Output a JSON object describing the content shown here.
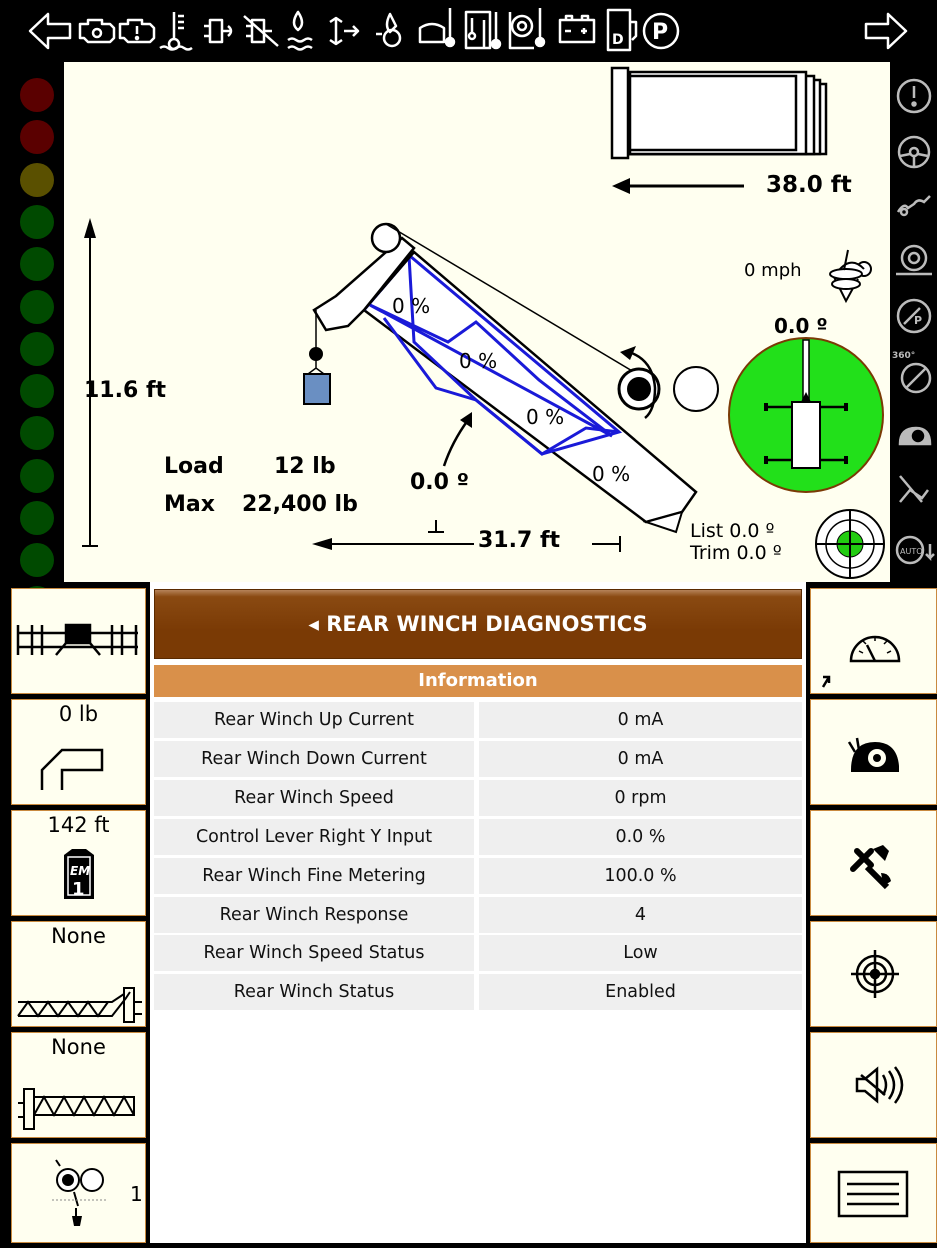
{
  "top_bar": {
    "icons": [
      "nav-left-arrow-icon",
      "engine-icon",
      "engine-warning-icon",
      "coolant-temp-icon",
      "fuel-filter-icon",
      "fuel-filter-restricted-icon",
      "water-in-fuel-icon",
      "air-filter-icon",
      "oil-pressure-icon",
      "hydraulic-temp-icon",
      "hydraulic-level-icon",
      "transmission-temp-icon",
      "battery-icon",
      "def-level-icon",
      "parking-brake-icon",
      "nav-right-arrow-icon"
    ],
    "indicator_colors": {
      "icon": "#ffffff",
      "background": "#000000"
    }
  },
  "warning_lights": [
    "#5a0000",
    "#5a0000",
    "#5a5000",
    "#004a00",
    "#004a00",
    "#004a00",
    "#004a00",
    "#004a00",
    "#004a00",
    "#004a00",
    "#004a00",
    "#004a00",
    "#004a00"
  ],
  "crane": {
    "boom_length": "38.0 ft",
    "height": "11.6 ft",
    "radius": "31.7  ft",
    "boom_angle": "0.0 º",
    "load_label": "Load",
    "load_value": "12  lb",
    "max_label": "Max",
    "max_value": "22,400  lb",
    "sections": [
      "0 %",
      "0 %",
      "0 %",
      "0 %"
    ],
    "wind": "0  mph",
    "swing": "0.0 º",
    "list": "List 0.0 º",
    "trim": "Trim 0.0 º",
    "swing_area_color": "#22e01a",
    "level_bubble_color": "#22cc11",
    "boom_section_color": "#1a1ad8"
  },
  "right_top_icons": [
    "warning-exclamation-icon",
    "steering-wheel-icon",
    "outrigger-icon",
    "engine-gear-icon",
    "speed-limit-icon",
    "360-swing-icon",
    "creep-mode-icon",
    "transmission-icon",
    "auto-rpm-icon"
  ],
  "left_panel": {
    "outrigger_config_icon": "outrigger-config-icon",
    "hook_weight": "0 lb",
    "boom_length_limit": "142 ft",
    "em_mode": "1",
    "jib_1": "None",
    "jib_2": "None",
    "winch_count": "1"
  },
  "diagnostics": {
    "title": "◂ REAR WINCH DIAGNOSTICS",
    "section": "Information",
    "rows": [
      {
        "label": "Rear Winch Up Current",
        "value": "0  mA"
      },
      {
        "label": "Rear Winch Down Current",
        "value": "0  mA"
      },
      {
        "label": "Rear Winch Speed",
        "value": "0  rpm"
      },
      {
        "label": "Control Lever Right Y Input",
        "value": "0.0 %"
      },
      {
        "label": "Rear Winch Fine Metering",
        "value": "100.0 %"
      },
      {
        "label": "Rear Winch Response",
        "value": "4"
      },
      {
        "label": "Rear Winch Speed Status",
        "value": "Low"
      },
      {
        "label": "Rear Winch Status",
        "value": "Enabled"
      }
    ],
    "colors": {
      "header": "#7a3a05",
      "subheader": "#d9904a",
      "row": "#efefef"
    }
  },
  "right_panel": {
    "buttons": [
      "speedometer-icon",
      "creep-speed-icon",
      "tools-icon",
      "target-icon",
      "speaker-mute-icon",
      "menu-icon"
    ]
  }
}
